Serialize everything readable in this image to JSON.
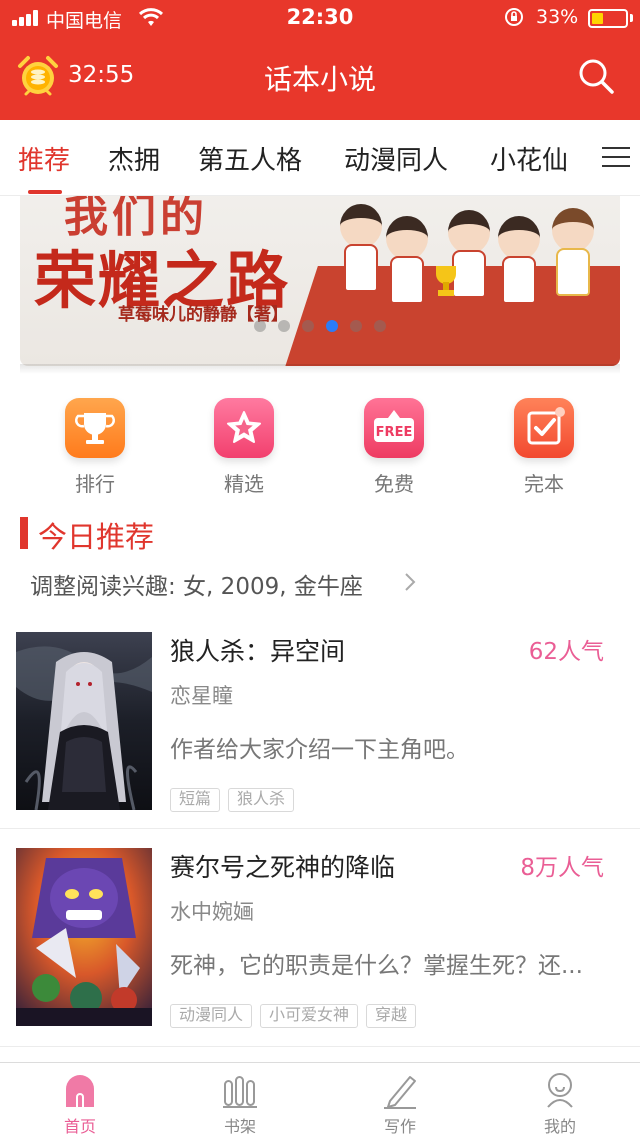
{
  "status_bar": {
    "carrier": "中国电信",
    "time": "22:30",
    "battery_percent": "33%",
    "battery_level": 0.33
  },
  "header": {
    "timer": "32:55",
    "title": "话本小说",
    "alarm_icon": "alarm-clock-icon",
    "search_icon": "search-icon"
  },
  "tabs": {
    "items": [
      {
        "label": "推荐",
        "active": true
      },
      {
        "label": "杰拥"
      },
      {
        "label": "第五人格"
      },
      {
        "label": "动漫同人"
      },
      {
        "label": "小花仙"
      }
    ],
    "menu_icon": "menu-icon"
  },
  "banner": {
    "title_line1": "我们的",
    "title_line2": "荣耀之路",
    "author": "草莓味儿的静静【著】",
    "slide_count": 6,
    "active_slide": 4
  },
  "quick_entries": [
    {
      "label": "排行",
      "icon": "trophy-icon"
    },
    {
      "label": "精选",
      "icon": "star-icon"
    },
    {
      "label": "免费",
      "icon": "free-tag-icon",
      "icon_text": "FREE"
    },
    {
      "label": "完本",
      "icon": "checkmark-icon"
    }
  ],
  "section": {
    "title": "今日推荐",
    "interest": "调整阅读兴趣: 女, 2009, 金牛座"
  },
  "books": [
    {
      "title": "狼人杀：异空间",
      "popularity": "62人气",
      "author": "恋星瞳",
      "description": "作者给大家介绍一下主角吧。",
      "tags": [
        "短篇",
        "狼人杀"
      ]
    },
    {
      "title": "赛尔号之死神的降临",
      "popularity": "8万人气",
      "author": "水中婉婳",
      "description": "死神，它的职责是什么？掌握生死？还...",
      "tags": [
        "动漫同人",
        "小可爱女神",
        "穿越"
      ]
    }
  ],
  "tabbar": {
    "items": [
      {
        "label": "首页",
        "icon": "home-icon",
        "active": true
      },
      {
        "label": "书架",
        "icon": "bookshelf-icon"
      },
      {
        "label": "写作",
        "icon": "pen-icon"
      },
      {
        "label": "我的",
        "icon": "profile-icon"
      }
    ]
  },
  "colors": {
    "brand_red": "#e8372b",
    "accent_pink": "#ea5e95",
    "active_dot": "#2c7cf6"
  }
}
